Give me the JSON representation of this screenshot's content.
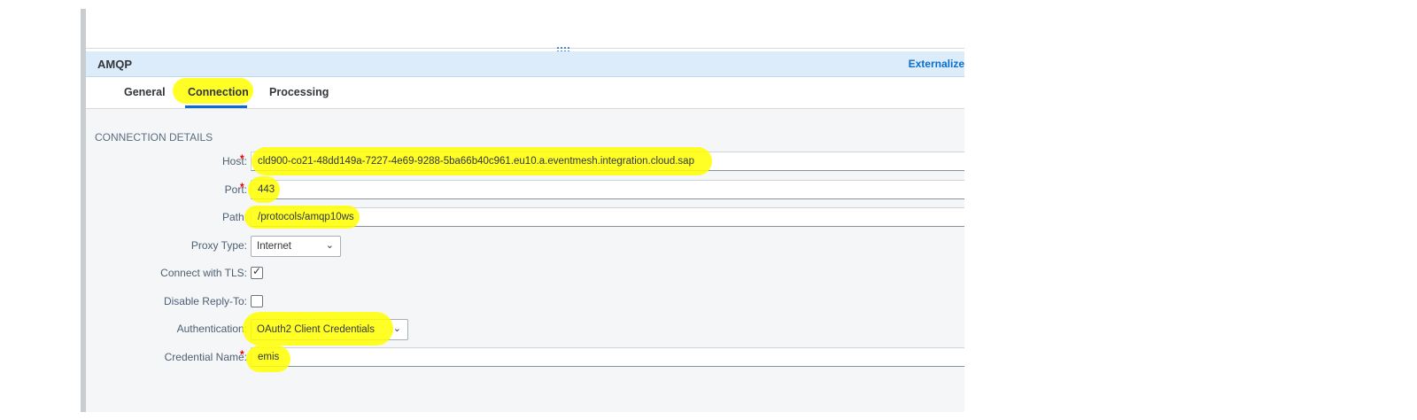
{
  "panel": {
    "title": "AMQP",
    "externalize_label": "Externalize"
  },
  "tabs": [
    {
      "label": "General"
    },
    {
      "label": "Connection",
      "active": true
    },
    {
      "label": "Processing"
    }
  ],
  "section": {
    "title": "CONNECTION DETAILS"
  },
  "fields": {
    "host": {
      "label": "Host:",
      "value": "cld900-co21-48dd149a-7227-4e69-9288-5ba66b40c961.eu10.a.eventmesh.integration.cloud.sap",
      "required": "*"
    },
    "port": {
      "label": "Port:",
      "value": "443",
      "required": "*"
    },
    "path": {
      "label": "Path:",
      "value": "/protocols/amqp10ws"
    },
    "proxy_type": {
      "label": "Proxy Type:",
      "value": "Internet"
    },
    "connect_tls": {
      "label": "Connect with TLS:",
      "checked": true
    },
    "disable_reply_to": {
      "label": "Disable Reply-To:",
      "checked": false
    },
    "authentication": {
      "label": "Authentication:",
      "value": "OAuth2 Client Credentials"
    },
    "credential_name": {
      "label": "Credential Name:",
      "value": "emis",
      "required": "*"
    }
  },
  "icons": {
    "grip": "drag-handle-icon",
    "chevron": "chevron-down-icon",
    "check": "checkmark-icon"
  },
  "colors": {
    "accent": "#0a6ed1",
    "header_bg": "#dcecfb",
    "highlight": "#ffff00",
    "required": "#e00000"
  }
}
